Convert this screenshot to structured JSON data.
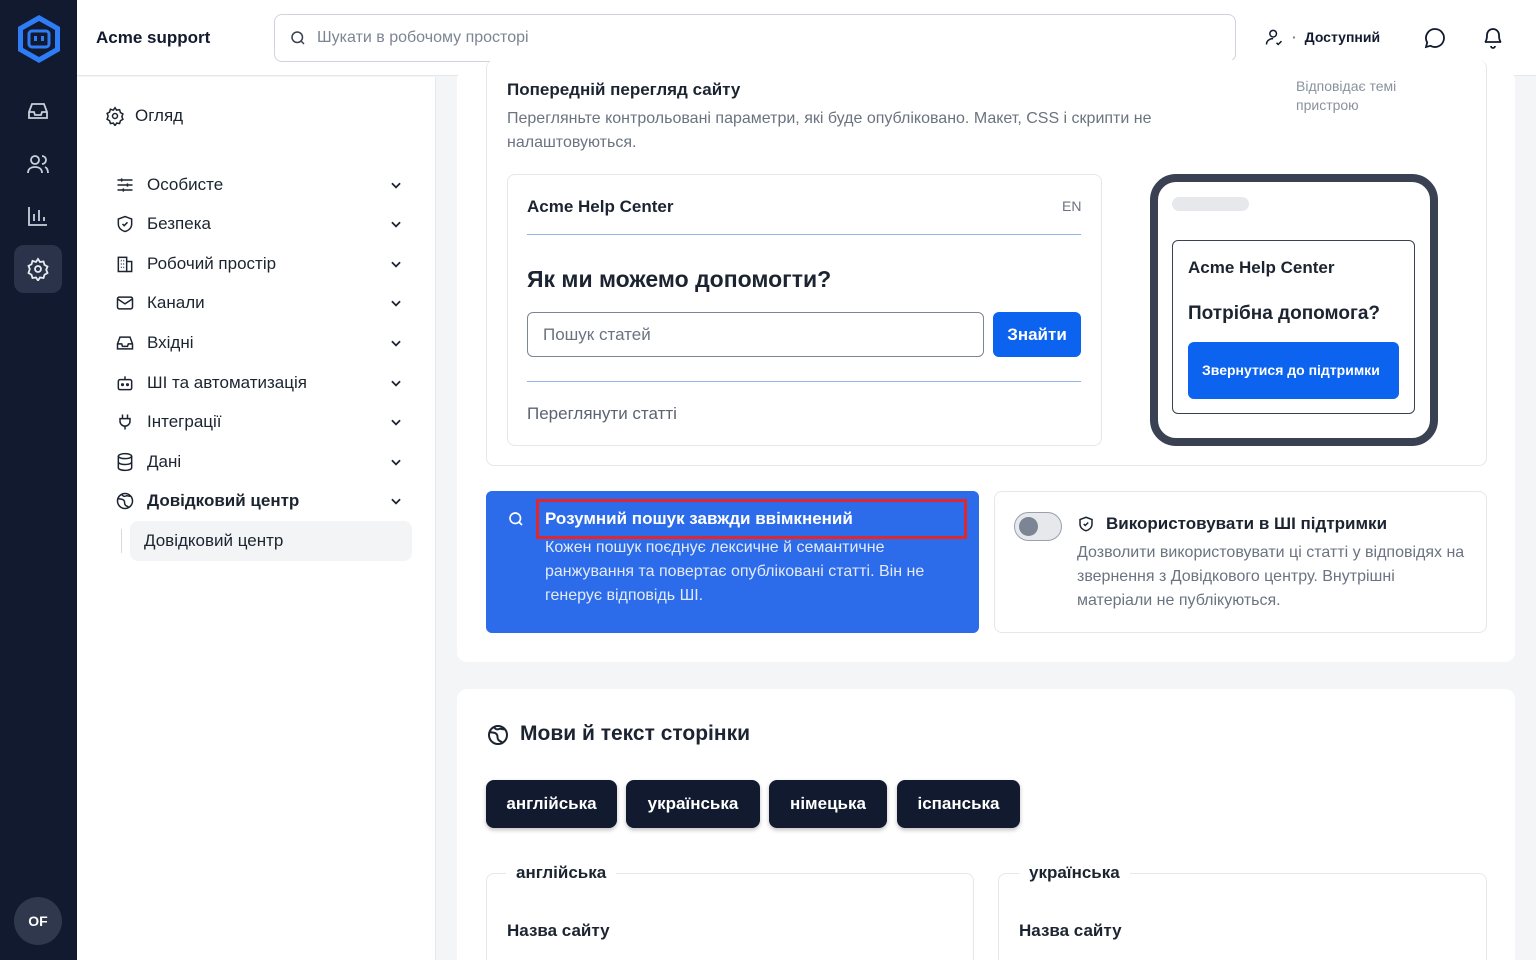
{
  "app": {
    "brand": "Acme support",
    "avatar_initials": "OF",
    "search_placeholder": "Шукати в робочому просторі",
    "status_label": "Доступний",
    "status_separator": "·"
  },
  "sidebar": {
    "overview": "Огляд",
    "items": [
      {
        "label": "Особисте",
        "icon": "sliders-icon"
      },
      {
        "label": "Безпека",
        "icon": "shield-icon"
      },
      {
        "label": "Робочий простір",
        "icon": "building-icon"
      },
      {
        "label": "Канали",
        "icon": "mail-icon"
      },
      {
        "label": "Вхідні",
        "icon": "inbox-icon"
      },
      {
        "label": "ШІ та автоматизація",
        "icon": "bot-icon"
      },
      {
        "label": "Інтеграції",
        "icon": "plug-icon"
      },
      {
        "label": "Дані",
        "icon": "database-icon"
      },
      {
        "label": "Довідковий центр",
        "icon": "globe-icon"
      }
    ],
    "sub_item": "Довідковий центр"
  },
  "preview": {
    "title": "Попередній перегляд сайту",
    "description": "Перегляньте контрольовані параметри, які буде опубліковано. Макет, CSS і скрипти не налаштовуються.",
    "device_note": "Відповідає темі пристрою",
    "desktop": {
      "site_title": "Acme Help Center",
      "lang": "EN",
      "heading": "Як ми можемо допомогти?",
      "search_placeholder": "Пошук статей",
      "search_button": "Знайти",
      "browse_link": "Переглянути статті"
    },
    "mobile": {
      "site_title": "Acme Help Center",
      "heading": "Потрібна допомога?",
      "contact_button": "Звернутися до підтримки"
    }
  },
  "smart_search": {
    "title": "Розумний пошук завжди ввімкнений",
    "description": "Кожен пошук поєднує лексичне й семантичне ранжування та повертає опубліковані статті. Він не генерує відповідь ШІ."
  },
  "ai_support": {
    "title": "Використовувати в ШІ підтримки",
    "description": "Дозволити використовувати ці статті у відповідях на звернення з Довідкового центру. Внутрішні матеріали не публікуються.",
    "enabled": false
  },
  "languages": {
    "title": "Мови й текст сторінки",
    "chips": [
      "англійська",
      "українська",
      "німецька",
      "іспанська"
    ],
    "columns": [
      {
        "legend": "англійська",
        "field_label": "Назва сайту"
      },
      {
        "legend": "українська",
        "field_label": "Назва сайту"
      }
    ]
  },
  "colors": {
    "rail": "#111a2e",
    "accent": "#0b63f0",
    "smart_card": "#2c6be9",
    "highlight": "#e0262e"
  }
}
